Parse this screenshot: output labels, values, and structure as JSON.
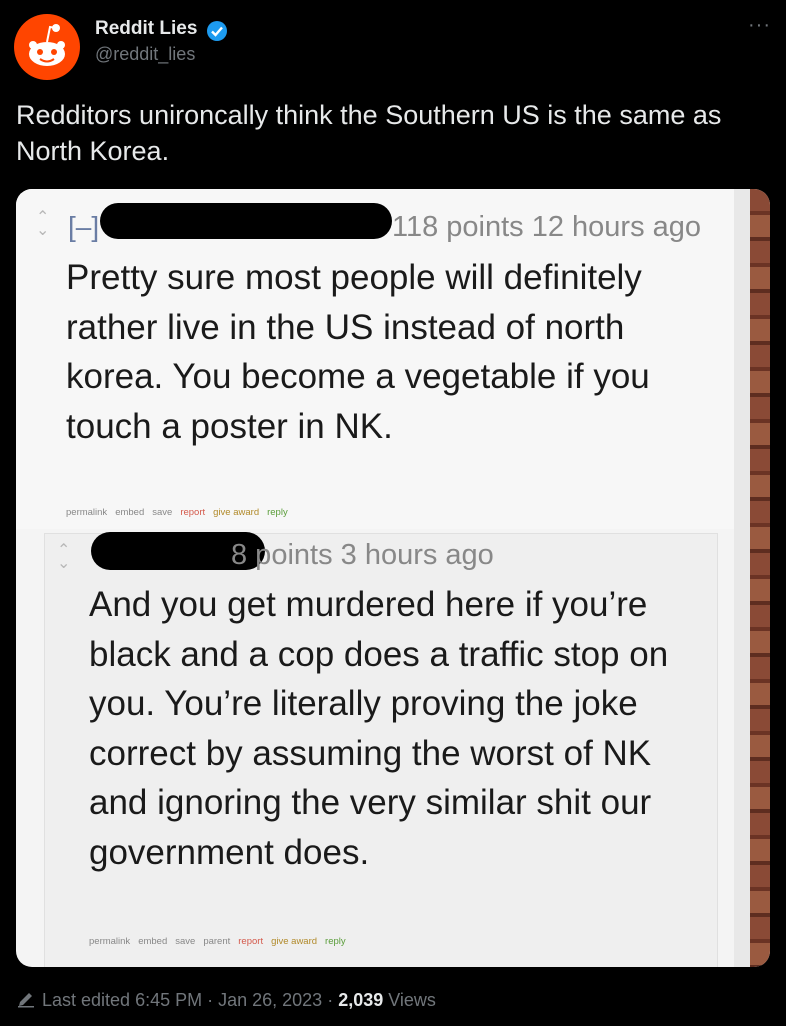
{
  "author": {
    "display_name": "Reddit Lies",
    "handle": "@reddit_lies",
    "verified_icon": "verified-badge-icon",
    "brand_color": "#ff4500"
  },
  "more_label": "···",
  "tweet_text": "Redditors unironcally think the Southern US is the same as North Korea.",
  "screenshot": {
    "comment1": {
      "collapse": "[–]",
      "meta": "118 points 12 hours ago",
      "body": "Pretty sure most people will definitely rather live in the US instead of north korea. You become a vegetable if you touch a poster in NK.",
      "links": [
        "permalink",
        "embed",
        "save",
        "report",
        "give award",
        "reply"
      ]
    },
    "comment2": {
      "meta": "8 points 3 hours ago",
      "body": "And you get murdered here if you’re black and a cop does a traffic stop on you. You’re literally proving the joke correct by assuming the worst of NK and ignoring the very similar shit our government does.",
      "links": [
        "permalink",
        "embed",
        "save",
        "parent",
        "report",
        "give award",
        "reply"
      ]
    }
  },
  "footer": {
    "edited": "Last edited 6:45 PM · Jan 26, 2023 · ",
    "views_count": "2,039",
    "views_label": " Views"
  }
}
